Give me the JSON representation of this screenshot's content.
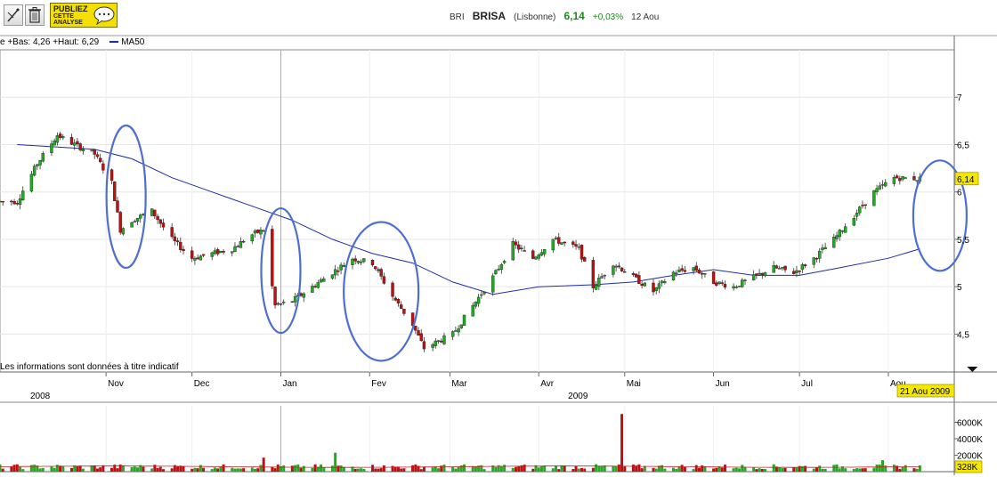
{
  "toolbar": {
    "tool_icon": "crosshair-pen-icon",
    "trash_icon": "trash-icon",
    "publish_line1": "PUBLIEZ",
    "publish_line2": "CETTE",
    "publish_line3": "ANALYSE",
    "publish_icon": "speech-bubble-icon"
  },
  "quote": {
    "code": "BRI",
    "name": "BRISA",
    "exchange": "(Lisbonne)",
    "price": "6,14",
    "change": "+0,03%",
    "date": "12 Aou"
  },
  "legend": {
    "range_text": "e +Bas: 4,26 +Haut: 6,29",
    "ma_label": "MA50"
  },
  "colors": {
    "up": "#22aa22",
    "down": "#bb1111",
    "ma": "#1e2ea8",
    "ellipse": "#4f6fd0",
    "current_tag": "#f4e800"
  },
  "chart_data": [
    {
      "type": "candlestick",
      "title": "",
      "ylim": [
        4.1,
        7.5
      ],
      "y_ticks": [
        "7",
        "6,5",
        "6",
        "5,5",
        "5",
        "4,5"
      ],
      "x_ticks": [
        "Nov",
        "Dec",
        "Jan",
        "Fev",
        "Mar",
        "Avr",
        "Mai",
        "Jun",
        "Jul",
        "Aou"
      ],
      "year_labels": [
        "2008",
        "2009"
      ],
      "disclaimer": "Les informations sont données à titre indicatif",
      "last_price_label": "6,14",
      "cursor_date_label": "21 Aou 2009",
      "grid": true,
      "price_points": [
        [
          "2008-10-01",
          5.9
        ],
        [
          "2008-10-08",
          6.3
        ],
        [
          "2008-10-15",
          6.6
        ],
        [
          "2008-10-21",
          6.5
        ],
        [
          "2008-10-28",
          6.4
        ],
        [
          "2008-11-03",
          6.1
        ],
        [
          "2008-11-06",
          5.6
        ],
        [
          "2008-11-10",
          5.7
        ],
        [
          "2008-11-17",
          5.8
        ],
        [
          "2008-11-24",
          5.5
        ],
        [
          "2008-12-01",
          5.3
        ],
        [
          "2008-12-08",
          5.35
        ],
        [
          "2008-12-15",
          5.4
        ],
        [
          "2008-12-22",
          5.55
        ],
        [
          "2008-12-26",
          5.6
        ],
        [
          "2008-12-30",
          4.8
        ],
        [
          "2009-01-05",
          4.85
        ],
        [
          "2009-01-12",
          5.0
        ],
        [
          "2009-01-19",
          5.15
        ],
        [
          "2009-01-26",
          5.3
        ],
        [
          "2009-02-02",
          5.25
        ],
        [
          "2009-02-09",
          4.9
        ],
        [
          "2009-02-16",
          4.6
        ],
        [
          "2009-02-20",
          4.35
        ],
        [
          "2009-03-02",
          4.5
        ],
        [
          "2009-03-09",
          4.8
        ],
        [
          "2009-03-16",
          5.1
        ],
        [
          "2009-03-23",
          5.45
        ],
        [
          "2009-03-30",
          5.3
        ],
        [
          "2009-04-06",
          5.5
        ],
        [
          "2009-04-15",
          5.4
        ],
        [
          "2009-04-20",
          5.0
        ],
        [
          "2009-04-27",
          5.25
        ],
        [
          "2009-05-04",
          5.1
        ],
        [
          "2009-05-11",
          4.95
        ],
        [
          "2009-05-18",
          5.15
        ],
        [
          "2009-05-25",
          5.2
        ],
        [
          "2009-06-01",
          5.05
        ],
        [
          "2009-06-08",
          5.0
        ],
        [
          "2009-06-15",
          5.1
        ],
        [
          "2009-06-22",
          5.2
        ],
        [
          "2009-06-29",
          5.15
        ],
        [
          "2009-07-06",
          5.3
        ],
        [
          "2009-07-13",
          5.5
        ],
        [
          "2009-07-20",
          5.75
        ],
        [
          "2009-07-27",
          6.0
        ],
        [
          "2009-08-03",
          6.15
        ],
        [
          "2009-08-12",
          6.14
        ]
      ],
      "ma50_points": [
        [
          "2008-10-01",
          6.5
        ],
        [
          "2008-10-28",
          6.45
        ],
        [
          "2008-11-10",
          6.35
        ],
        [
          "2008-11-24",
          6.15
        ],
        [
          "2008-12-08",
          6.0
        ],
        [
          "2008-12-22",
          5.85
        ],
        [
          "2009-01-05",
          5.7
        ],
        [
          "2009-01-19",
          5.5
        ],
        [
          "2009-02-02",
          5.35
        ],
        [
          "2009-02-16",
          5.25
        ],
        [
          "2009-03-02",
          5.05
        ],
        [
          "2009-03-16",
          4.92
        ],
        [
          "2009-04-01",
          5.0
        ],
        [
          "2009-04-20",
          5.02
        ],
        [
          "2009-05-04",
          5.05
        ],
        [
          "2009-05-18",
          5.12
        ],
        [
          "2009-06-01",
          5.18
        ],
        [
          "2009-06-15",
          5.12
        ],
        [
          "2009-07-01",
          5.12
        ],
        [
          "2009-07-15",
          5.2
        ],
        [
          "2009-08-01",
          5.3
        ],
        [
          "2009-08-12",
          5.4
        ]
      ]
    },
    {
      "type": "bar",
      "title": "",
      "ylim": [
        0,
        8000
      ],
      "y_ticks": [
        "6000K",
        "4000K",
        "2000K"
      ],
      "last_volume_label": "328K",
      "spikes": [
        [
          "2009-04-30",
          7000
        ],
        [
          "2009-01-20",
          2300
        ],
        [
          "2008-12-26",
          1700
        ],
        [
          "2009-07-30",
          1400
        ]
      ]
    }
  ]
}
